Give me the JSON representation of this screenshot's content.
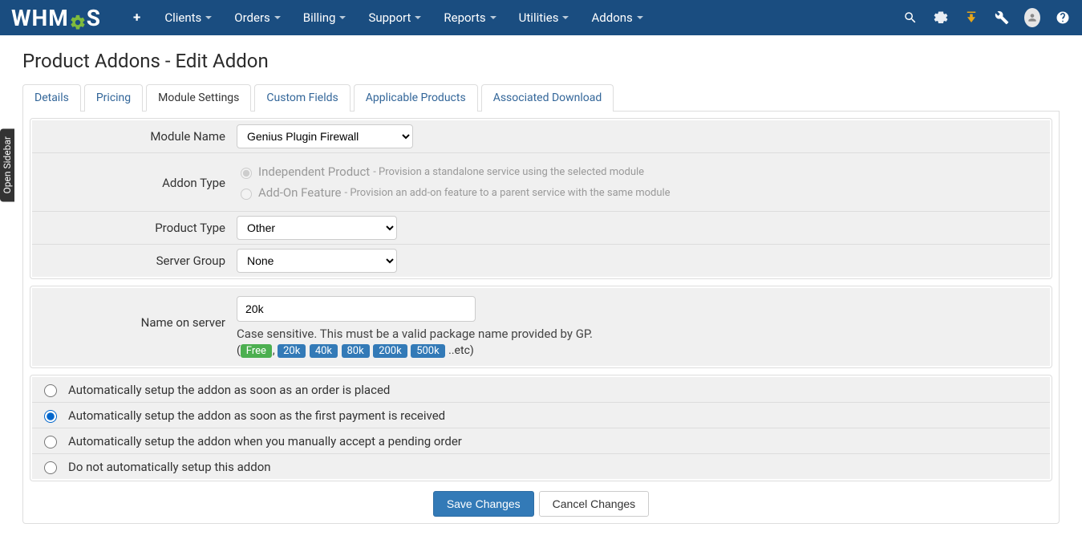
{
  "logo_text_prefix": "WHM",
  "logo_text_suffix": "S",
  "nav": {
    "items": [
      "Clients",
      "Orders",
      "Billing",
      "Support",
      "Reports",
      "Utilities",
      "Addons"
    ]
  },
  "sidebar_toggle": "Open Sidebar",
  "page_title": "Product Addons - Edit Addon",
  "tabs": {
    "details": "Details",
    "pricing": "Pricing",
    "module_settings": "Module Settings",
    "custom_fields": "Custom Fields",
    "applicable_products": "Applicable Products",
    "associated_download": "Associated Download"
  },
  "fields": {
    "module_name": {
      "label": "Module Name",
      "value": "Genius Plugin Firewall"
    },
    "addon_type": {
      "label": "Addon Type",
      "options": [
        {
          "label": "Independent Product",
          "desc": "- Provision a standalone service using the selected module",
          "checked": true
        },
        {
          "label": "Add-On Feature",
          "desc": "- Provision an add-on feature to a parent service with the same module",
          "checked": false
        }
      ]
    },
    "product_type": {
      "label": "Product Type",
      "value": "Other"
    },
    "server_group": {
      "label": "Server Group",
      "value": "None"
    },
    "name_on_server": {
      "label": "Name on server",
      "value": "20k",
      "help": "Case sensitive. This must be a valid package name provided by GP.",
      "tag_free": "Free",
      "tags": [
        "20k",
        "40k",
        "80k",
        "200k",
        "500k"
      ],
      "tags_open": "(",
      "tags_sep": ", ",
      "tags_etc": " ..etc)"
    }
  },
  "auto_setup": {
    "options": [
      "Automatically setup the addon as soon as an order is placed",
      "Automatically setup the addon as soon as the first payment is received",
      "Automatically setup the addon when you manually accept a pending order",
      "Do not automatically setup this addon"
    ],
    "selected_index": 1
  },
  "actions": {
    "save": "Save Changes",
    "cancel": "Cancel Changes"
  }
}
